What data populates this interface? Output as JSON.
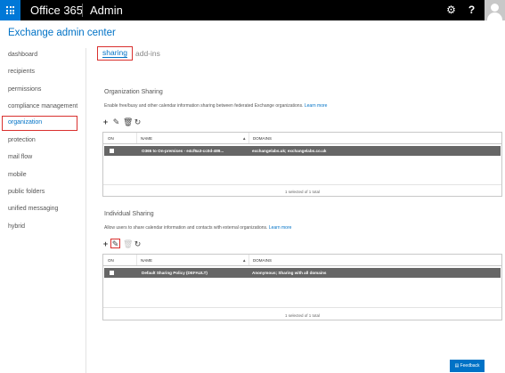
{
  "topbar": {
    "brand": "Office 365",
    "app": "Admin",
    "icons": [
      "app-launcher-icon",
      "gear-icon",
      "help-icon",
      "avatar"
    ]
  },
  "header": {
    "title": "Exchange admin center"
  },
  "sidebar": {
    "items": [
      {
        "label": "dashboard"
      },
      {
        "label": "recipients"
      },
      {
        "label": "permissions"
      },
      {
        "label": "compliance management"
      },
      {
        "label": "organization",
        "active": true
      },
      {
        "label": "protection"
      },
      {
        "label": "mail flow"
      },
      {
        "label": "mobile"
      },
      {
        "label": "public folders"
      },
      {
        "label": "unified messaging"
      },
      {
        "label": "hybrid"
      }
    ]
  },
  "tabs": {
    "sharing": "sharing",
    "addins": "add-ins"
  },
  "org_sharing": {
    "title": "Organization Sharing",
    "description": "Enable free/busy and other calendar information sharing between federated Exchange organizations.",
    "learn_more": "Learn more",
    "columns": {
      "on": "ON",
      "name": "NAME",
      "domains": "DOMAINS"
    },
    "rows": [
      {
        "name": "O365 to On-premises - e4cf6a3-cc0d-489...",
        "domains": "exchangelabs.uk; exchangelabs.co.uk"
      }
    ],
    "footer": "1 selected of 1 total"
  },
  "ind_sharing": {
    "title": "Individual Sharing",
    "description": "Allow users to share calendar information and contacts with external organizations.",
    "learn_more": "Learn more",
    "columns": {
      "on": "ON",
      "name": "NAME",
      "domains": "DOMAINS"
    },
    "rows": [
      {
        "name": "Default Sharing Policy (DEFAULT)",
        "domains": "Anonymous; Sharing with all domains"
      }
    ],
    "footer": "1 selected of 1 total"
  },
  "feedback": {
    "label": "Feedback"
  },
  "colors": {
    "brand_blue": "#0072c6",
    "topbar": "#000000",
    "waffle": "#0078d7",
    "highlight_red": "#d9302e",
    "selected_row": "#666666"
  }
}
